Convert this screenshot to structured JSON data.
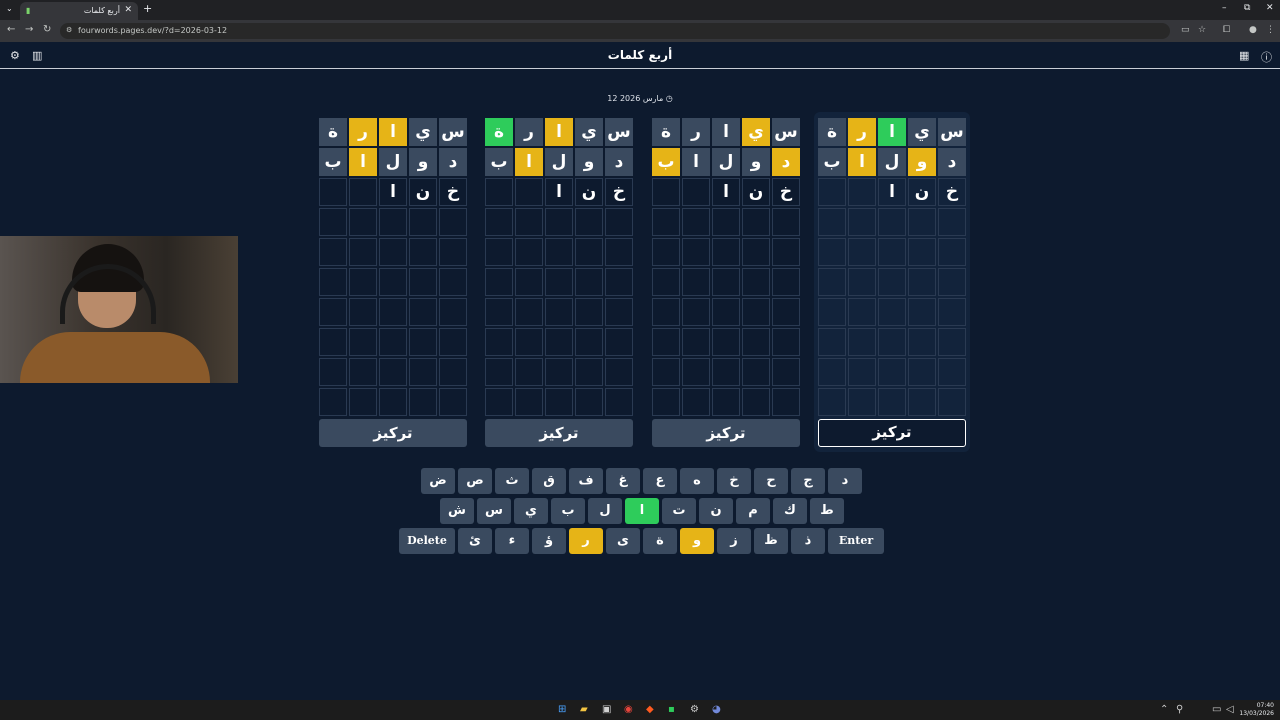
{
  "browser": {
    "tab_title": "أربع كلمات",
    "url": "fourwords.pages.dev/?d=2026-03-12"
  },
  "app": {
    "title": "أربع كلمات",
    "date": "12 مارس 2026"
  },
  "boards": [
    {
      "rows": [
        [
          {
            "l": "س",
            "s": "filled"
          },
          {
            "l": "ي",
            "s": "filled"
          },
          {
            "l": "ا",
            "s": "correct"
          },
          {
            "l": "ر",
            "s": "present"
          },
          {
            "l": "ة",
            "s": "filled"
          }
        ],
        [
          {
            "l": "د",
            "s": "filled"
          },
          {
            "l": "و",
            "s": "present"
          },
          {
            "l": "ل",
            "s": "filled"
          },
          {
            "l": "ا",
            "s": "present"
          },
          {
            "l": "ب",
            "s": "filled"
          }
        ],
        [
          {
            "l": "خ",
            "s": "empty"
          },
          {
            "l": "ن",
            "s": "empty"
          },
          {
            "l": "ا",
            "s": "empty"
          },
          {
            "l": "",
            "s": "empty"
          },
          {
            "l": "",
            "s": "empty"
          }
        ]
      ],
      "focus_label": "تركيز",
      "active": true
    },
    {
      "rows": [
        [
          {
            "l": "س",
            "s": "filled"
          },
          {
            "l": "ي",
            "s": "present"
          },
          {
            "l": "ا",
            "s": "filled"
          },
          {
            "l": "ر",
            "s": "filled"
          },
          {
            "l": "ة",
            "s": "filled"
          }
        ],
        [
          {
            "l": "د",
            "s": "present"
          },
          {
            "l": "و",
            "s": "filled"
          },
          {
            "l": "ل",
            "s": "filled"
          },
          {
            "l": "ا",
            "s": "filled"
          },
          {
            "l": "ب",
            "s": "present"
          }
        ],
        [
          {
            "l": "خ",
            "s": "empty"
          },
          {
            "l": "ن",
            "s": "empty"
          },
          {
            "l": "ا",
            "s": "empty"
          },
          {
            "l": "",
            "s": "empty"
          },
          {
            "l": "",
            "s": "empty"
          }
        ]
      ],
      "focus_label": "تركيز",
      "active": false
    },
    {
      "rows": [
        [
          {
            "l": "س",
            "s": "filled"
          },
          {
            "l": "ي",
            "s": "filled"
          },
          {
            "l": "ا",
            "s": "present"
          },
          {
            "l": "ر",
            "s": "filled"
          },
          {
            "l": "ة",
            "s": "correct"
          }
        ],
        [
          {
            "l": "د",
            "s": "filled"
          },
          {
            "l": "و",
            "s": "filled"
          },
          {
            "l": "ل",
            "s": "filled"
          },
          {
            "l": "ا",
            "s": "present"
          },
          {
            "l": "ب",
            "s": "filled"
          }
        ],
        [
          {
            "l": "خ",
            "s": "empty"
          },
          {
            "l": "ن",
            "s": "empty"
          },
          {
            "l": "ا",
            "s": "empty"
          },
          {
            "l": "",
            "s": "empty"
          },
          {
            "l": "",
            "s": "empty"
          }
        ]
      ],
      "focus_label": "تركيز",
      "active": false
    },
    {
      "rows": [
        [
          {
            "l": "س",
            "s": "filled"
          },
          {
            "l": "ي",
            "s": "filled"
          },
          {
            "l": "ا",
            "s": "present"
          },
          {
            "l": "ر",
            "s": "present"
          },
          {
            "l": "ة",
            "s": "filled"
          }
        ],
        [
          {
            "l": "د",
            "s": "filled"
          },
          {
            "l": "و",
            "s": "filled"
          },
          {
            "l": "ل",
            "s": "filled"
          },
          {
            "l": "ا",
            "s": "present"
          },
          {
            "l": "ب",
            "s": "filled"
          }
        ],
        [
          {
            "l": "خ",
            "s": "empty"
          },
          {
            "l": "ن",
            "s": "empty"
          },
          {
            "l": "ا",
            "s": "empty"
          },
          {
            "l": "",
            "s": "empty"
          },
          {
            "l": "",
            "s": "empty"
          }
        ]
      ],
      "focus_label": "تركيز",
      "active": false
    }
  ],
  "keyboard": {
    "row1": [
      {
        "k": "د"
      },
      {
        "k": "ج"
      },
      {
        "k": "ح"
      },
      {
        "k": "خ"
      },
      {
        "k": "ه"
      },
      {
        "k": "ع"
      },
      {
        "k": "غ"
      },
      {
        "k": "ف"
      },
      {
        "k": "ق"
      },
      {
        "k": "ث"
      },
      {
        "k": "ص"
      },
      {
        "k": "ض"
      }
    ],
    "row2": [
      {
        "k": "ط"
      },
      {
        "k": "ك"
      },
      {
        "k": "م"
      },
      {
        "k": "ن"
      },
      {
        "k": "ت"
      },
      {
        "k": "ا",
        "s": "correct"
      },
      {
        "k": "ل"
      },
      {
        "k": "ب"
      },
      {
        "k": "ي"
      },
      {
        "k": "س"
      },
      {
        "k": "ش"
      }
    ],
    "row3": [
      {
        "k": "Enter",
        "w": true
      },
      {
        "k": "ذ"
      },
      {
        "k": "ظ"
      },
      {
        "k": "ز"
      },
      {
        "k": "و",
        "s": "present"
      },
      {
        "k": "ة"
      },
      {
        "k": "ى"
      },
      {
        "k": "ر",
        "s": "present"
      },
      {
        "k": "ؤ"
      },
      {
        "k": "ء"
      },
      {
        "k": "ئ"
      },
      {
        "k": "Delete",
        "w": true
      }
    ]
  },
  "clock": {
    "time": "07:40",
    "date": "13/03/2026"
  }
}
